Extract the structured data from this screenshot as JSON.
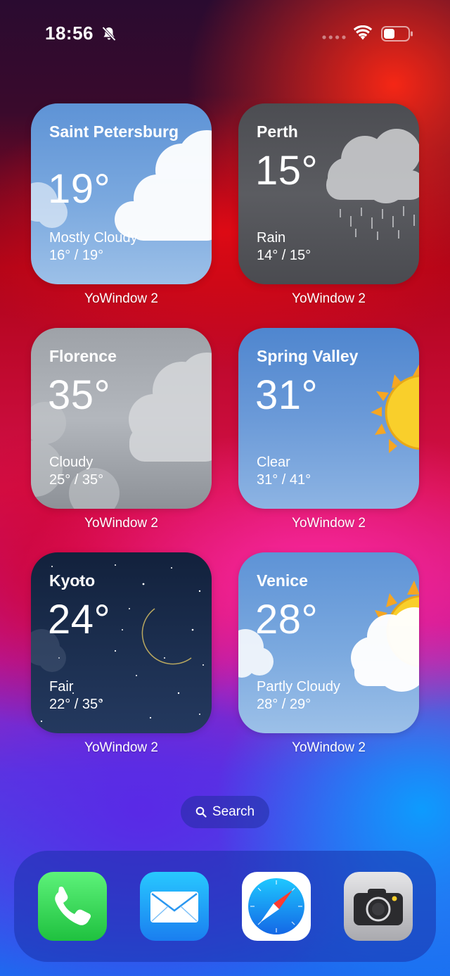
{
  "status_bar": {
    "time": "18:56",
    "icons": [
      "silent-bell-icon",
      "cellular-dots-icon",
      "wifi-icon",
      "battery-icon"
    ]
  },
  "widgets": [
    {
      "app": "YoWindow 2",
      "city": "Saint Petersburg",
      "temp": "19°",
      "condition": "Mostly Cloudy",
      "range": "16° / 19°",
      "scene": "cloudy-day"
    },
    {
      "app": "YoWindow 2",
      "city": "Perth",
      "temp": "15°",
      "condition": "Rain",
      "range": "14° / 15°",
      "scene": "rain"
    },
    {
      "app": "YoWindow 2",
      "city": "Florence",
      "temp": "35°",
      "condition": "Cloudy",
      "range": "25° / 35°",
      "scene": "overcast"
    },
    {
      "app": "YoWindow 2",
      "city": "Spring Valley",
      "temp": "31°",
      "condition": "Clear",
      "range": "31° / 41°",
      "scene": "sunny"
    },
    {
      "app": "YoWindow 2",
      "city": "Kyoto",
      "temp": "24°",
      "condition": "Fair",
      "range": "22° / 35°",
      "scene": "night-moon"
    },
    {
      "app": "YoWindow 2",
      "city": "Venice",
      "temp": "28°",
      "condition": "Partly Cloudy",
      "range": "28° / 29°",
      "scene": "partly-cloudy"
    }
  ],
  "search": {
    "label": "Search",
    "icon": "magnifier-icon"
  },
  "dock": {
    "apps": [
      {
        "name": "Phone",
        "icon": "phone-icon"
      },
      {
        "name": "Mail",
        "icon": "mail-icon"
      },
      {
        "name": "Safari",
        "icon": "compass-icon"
      },
      {
        "name": "Camera",
        "icon": "camera-icon"
      }
    ]
  },
  "colors": {
    "phone_green": "#34c759",
    "mail_blue": "#1e9bf5",
    "safari_red": "#ff3b30",
    "camera_gray": "#8e8e93",
    "sun_yellow": "#f9cf2b"
  }
}
